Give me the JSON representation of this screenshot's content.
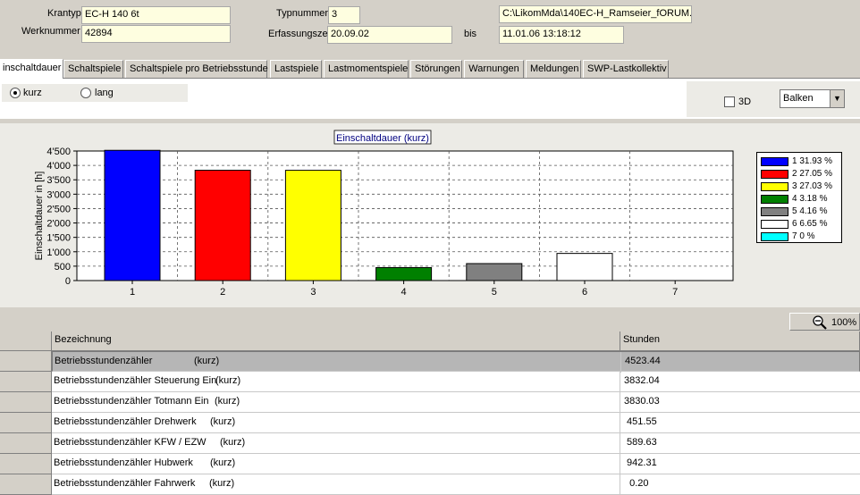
{
  "header": {
    "krantyp_label": "Krantyp",
    "krantyp_value": "EC-H 140 6t",
    "werknummer_label": "Werknummer",
    "werknummer_value": "42894",
    "typnummer_label": "Typnummer",
    "typnummer_value": "3",
    "erfassungszeit_label": "Erfassungszeit",
    "erfassungszeit_value": "20.09.02",
    "bis_label": "bis",
    "bis_value": "11.01.06  13:18:12",
    "path_value": "C:\\LikomMda\\140EC-H_Ramseier_fORUM."
  },
  "tabs": [
    {
      "label": "inschaltdauer"
    },
    {
      "label": "Schaltspiele"
    },
    {
      "label": "Schaltspiele pro Betriebsstunde"
    },
    {
      "label": "Lastspiele"
    },
    {
      "label": "Lastmomentspiele"
    },
    {
      "label": "Störungen"
    },
    {
      "label": "Warnungen"
    },
    {
      "label": "Meldungen"
    },
    {
      "label": "SWP-Lastkollektiv"
    }
  ],
  "options": {
    "radio_kurz": "kurz",
    "radio_lang": "lang",
    "check_3d": "3D",
    "chart_type_selected": "Balken"
  },
  "chart_data": {
    "type": "bar",
    "title": "Einschaltdauer (kurz)",
    "ylabel": "Einschaltdauer in [h]",
    "xlabel": "",
    "categories": [
      "1",
      "2",
      "3",
      "4",
      "5",
      "6",
      "7"
    ],
    "values": [
      4523.44,
      3832.04,
      3830.03,
      451.55,
      589.63,
      942.31,
      0.2
    ],
    "colors": [
      "#0000ff",
      "#ff0000",
      "#ffff00",
      "#008000",
      "#808080",
      "#ffffff",
      "#00ffff"
    ],
    "ylim": [
      0,
      4500
    ],
    "yticks": [
      "0",
      "500",
      "1'000",
      "1'500",
      "2'000",
      "2'500",
      "3'000",
      "3'500",
      "4'000",
      "4'500"
    ],
    "grid": true,
    "legend_position": "right",
    "legend": [
      "1 31.93 %",
      "2 27.05 %",
      "3 27.03 %",
      "4 3.18 %",
      "5 4.16 %",
      "6 6.65 %",
      "7 0 %"
    ]
  },
  "zoom": {
    "label": "100%"
  },
  "table": {
    "headers": [
      "Bezeichnung",
      "Stunden"
    ],
    "rows": [
      {
        "name": "Betriebsstundenzähler",
        "mode": "(kurz)",
        "value": "4523.44"
      },
      {
        "name": "Betriebsstundenzähler Steuerung Ein",
        "mode": "(kurz)",
        "value": "3832.04"
      },
      {
        "name": "Betriebsstundenzähler Totmann Ein",
        "mode": "(kurz)",
        "value": "3830.03"
      },
      {
        "name": "Betriebsstundenzähler Drehwerk",
        "mode": "(kurz)",
        "value": " 451.55"
      },
      {
        "name": "Betriebsstundenzähler KFW / EZW",
        "mode": "(kurz)",
        "value": " 589.63"
      },
      {
        "name": "Betriebsstundenzähler Hubwerk",
        "mode": "(kurz)",
        "value": " 942.31"
      },
      {
        "name": "Betriebsstundenzähler Fahrwerk",
        "mode": "(kurz)",
        "value": "  0.20"
      }
    ]
  }
}
